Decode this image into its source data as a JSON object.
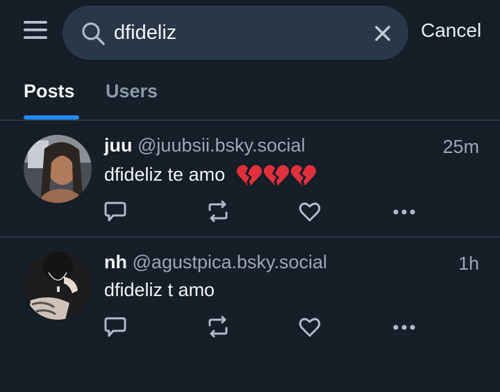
{
  "search": {
    "query": "dfideliz",
    "cancel_label": "Cancel"
  },
  "tabs": [
    {
      "label": "Posts",
      "active": true
    },
    {
      "label": "Users",
      "active": false
    }
  ],
  "posts": [
    {
      "name": "juu",
      "handle": "@juubsii.bsky.social",
      "time": "25m",
      "text": "dfideliz te amo",
      "emoji": "💔💔💔"
    },
    {
      "name": "nh",
      "handle": "@agustpica.bsky.social",
      "time": "1h",
      "text": "dfideliz t amo"
    }
  ],
  "colors": {
    "background": "#161e27",
    "search_bg": "#2a3746",
    "accent": "#208bfe",
    "muted": "#9aa7b5"
  }
}
